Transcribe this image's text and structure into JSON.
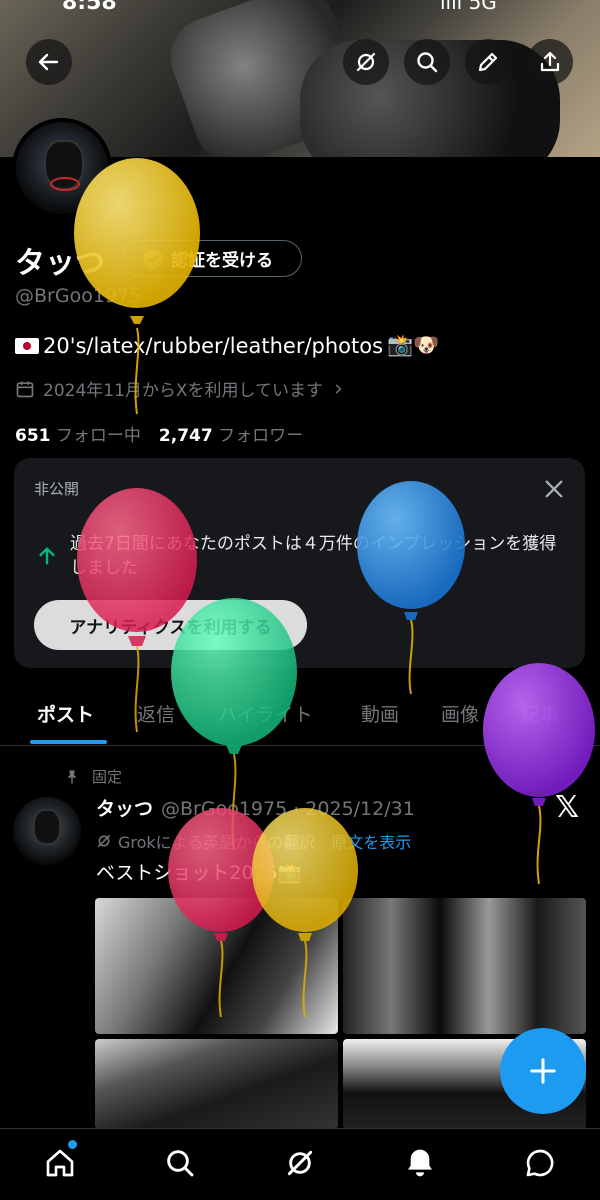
{
  "status_bar": {
    "time": "8:58",
    "signal": "ııll 5G"
  },
  "header": {
    "back_icon": "arrow-left-icon",
    "grok_icon": "grok-icon",
    "search_icon": "search-icon",
    "edit_icon": "pencil-icon",
    "share_icon": "share-icon"
  },
  "profile": {
    "name": "タッつ",
    "verify_label": "認証を受ける",
    "handle": "@BrGoo1975",
    "bio_text": "20's/latex/rubber/leather/photos",
    "bio_emoji": "📸🐶",
    "joined": "2024年11月からXを利用しています",
    "following_count": "651",
    "following_label": "フォロー中",
    "followers_count": "2,747",
    "followers_label": "フォロワー"
  },
  "analytics": {
    "private_label": "非公開",
    "message": "過去7日間にあなたのポストは４万件のインプレッションを獲得しました",
    "button": "アナリティクスを利用する"
  },
  "tabs": [
    "ポスト",
    "返信",
    "ハイライト",
    "動画",
    "画像",
    "記事"
  ],
  "post": {
    "pinned_label": "固定",
    "author": "タッつ",
    "handle_date": "@BrGoo1975 · 2025/12/31",
    "translate_label": "Grokによる英語からの翻訳",
    "show_original": "原文を表示",
    "text": "ベストショット2025📸"
  },
  "colors": {
    "accent": "#1d9bf0",
    "background": "#000000"
  }
}
